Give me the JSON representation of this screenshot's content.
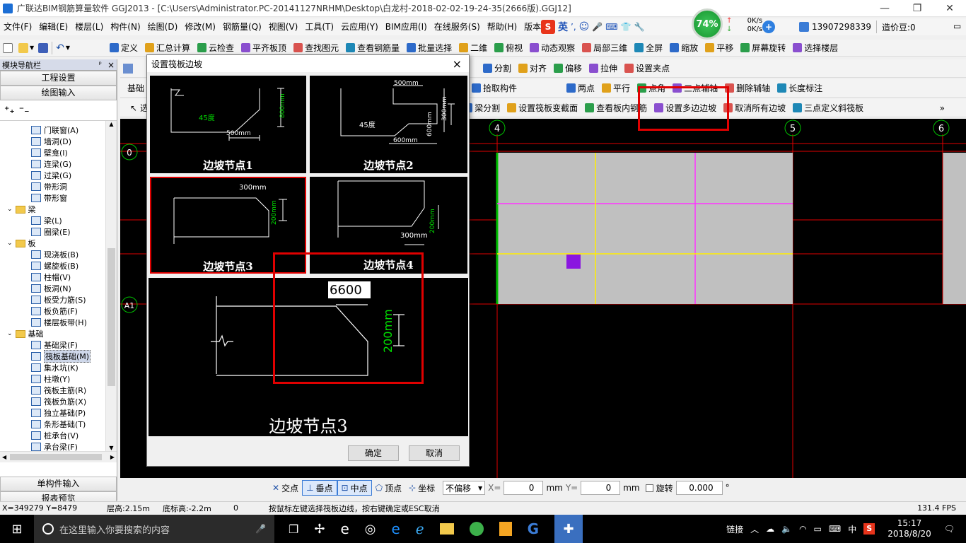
{
  "window": {
    "title": "广联达BIM钢筋算量软件 GGJ2013 - [C:\\Users\\Administrator.PC-20141127NRHM\\Desktop\\白龙村-2018-02-02-19-24-35(2666版).GGJ12]"
  },
  "menu": [
    "文件(F)",
    "编辑(E)",
    "楼层(L)",
    "构件(N)",
    "绘图(D)",
    "修改(M)",
    "钢筋量(Q)",
    "视图(V)",
    "工具(T)",
    "云应用(Y)",
    "BIM应用(I)",
    "在线服务(S)",
    "帮助(H)",
    "版本号"
  ],
  "ime": {
    "lang": "英",
    "punct": "’,"
  },
  "net": {
    "percent": "74%",
    "up": "0K/s",
    "down": "0K/s"
  },
  "account": {
    "phone": "13907298339",
    "beans": "造价豆:0"
  },
  "toolbar1": [
    "定义",
    "汇总计算",
    "云检查",
    "平齐板顶",
    "查找图元",
    "查看钢筋量",
    "批量选择",
    "二维",
    "俯视",
    "动态观察",
    "局部三维",
    "全屏",
    "缩放",
    "平移",
    "屏幕旋转",
    "选择楼层"
  ],
  "toolbar2": [
    "分割",
    "对齐",
    "偏移",
    "拉伸",
    "设置夹点"
  ],
  "toolbar3": [
    "拾取构件",
    "两点",
    "平行",
    "点角",
    "三点辅轴",
    "删除辅轴",
    "长度标注"
  ],
  "toolbar3_left": "基础",
  "toolbar4": [
    "梁分割",
    "设置筏板变截面",
    "查看板内钢筋",
    "设置多边边坡",
    "取消所有边坡",
    "三点定义斜筏板"
  ],
  "toolbar4_left": "选",
  "nav": {
    "title": "模块导航栏",
    "pin": "ᵖ",
    "close": "×",
    "btn_project": "工程设置",
    "btn_draw": "绘图输入",
    "btn_single": "单构件输入",
    "btn_report": "报表预览",
    "items": [
      {
        "label": "门联窗(A)",
        "type": "item"
      },
      {
        "label": "墙洞(D)",
        "type": "item"
      },
      {
        "label": "壁龛(I)",
        "type": "item"
      },
      {
        "label": "连梁(G)",
        "type": "item"
      },
      {
        "label": "过梁(G)",
        "type": "item"
      },
      {
        "label": "带形洞",
        "type": "item"
      },
      {
        "label": "带形窗",
        "type": "item"
      },
      {
        "label": "梁",
        "type": "folder"
      },
      {
        "label": "梁(L)",
        "type": "item"
      },
      {
        "label": "圈梁(E)",
        "type": "item"
      },
      {
        "label": "板",
        "type": "folder"
      },
      {
        "label": "现浇板(B)",
        "type": "item"
      },
      {
        "label": "螺旋板(B)",
        "type": "item"
      },
      {
        "label": "柱帽(V)",
        "type": "item"
      },
      {
        "label": "板洞(N)",
        "type": "item"
      },
      {
        "label": "板受力筋(S)",
        "type": "item"
      },
      {
        "label": "板负筋(F)",
        "type": "item"
      },
      {
        "label": "楼层板带(H)",
        "type": "item"
      },
      {
        "label": "基础",
        "type": "folder"
      },
      {
        "label": "基础梁(F)",
        "type": "item"
      },
      {
        "label": "筏板基础(M)",
        "type": "item",
        "selected": true
      },
      {
        "label": "集水坑(K)",
        "type": "item"
      },
      {
        "label": "柱墩(Y)",
        "type": "item"
      },
      {
        "label": "筏板主筋(R)",
        "type": "item"
      },
      {
        "label": "筏板负筋(X)",
        "type": "item"
      },
      {
        "label": "独立基础(P)",
        "type": "item"
      },
      {
        "label": "条形基础(T)",
        "type": "item"
      },
      {
        "label": "桩承台(V)",
        "type": "item"
      },
      {
        "label": "承台梁(F)",
        "type": "item"
      }
    ]
  },
  "axes": {
    "a4": "4",
    "a5": "5",
    "a6": "6",
    "a0": "0",
    "a1": "A1"
  },
  "dialog": {
    "title": "设置筏板边坡",
    "close": "×",
    "nodes": [
      {
        "label": "边坡节点1",
        "dim1": "800mm",
        "dim2": "500mm",
        "angle": "45度"
      },
      {
        "label": "边坡节点2",
        "dim1": "500mm",
        "dim2": "300mm",
        "dim3": "600mm",
        "dim4": "600mm",
        "angle": "45度"
      },
      {
        "label": "边坡节点3",
        "dim1": "300mm",
        "dim2": "200mm"
      },
      {
        "label": "边坡节点4",
        "dim1": "300mm",
        "dim2": "200mm"
      }
    ],
    "preview": {
      "label": "边坡节点3",
      "value": "6600",
      "dim": "200mm"
    },
    "ok": "确定",
    "cancel": "取消"
  },
  "snap": {
    "items": [
      "交点",
      "垂点",
      "中点",
      "顶点",
      "坐标"
    ],
    "offset": "不偏移",
    "x_label": "X=",
    "x": "0",
    "unit1": "mm",
    "y_label": "Y=",
    "y": "0",
    "unit2": "mm",
    "rotate_label": "旋转",
    "rotate": "0.000",
    "deg": "°"
  },
  "status": {
    "coords": "X=349279 Y=8479",
    "floor_h": "层高:2.15m",
    "base_h": "底标高:-2.2m",
    "zero": "0",
    "hint": "按鼠标左键选择筏板边线，按右键确定或ESC取消",
    "fps": "131.4 FPS"
  },
  "taskbar": {
    "search": "在这里输入你要搜索的内容",
    "link": "链接",
    "ime": "中",
    "time": "15:17",
    "date": "2018/8/20"
  }
}
